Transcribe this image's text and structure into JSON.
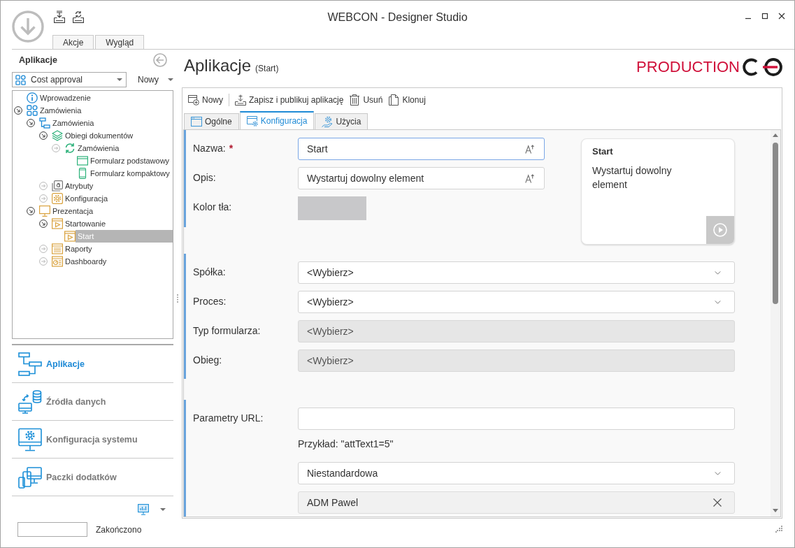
{
  "window": {
    "title": "WEBCON - Designer Studio"
  },
  "ribbon_tabs": [
    {
      "label": "Akcje",
      "selected": false
    },
    {
      "label": "Wygląd",
      "selected": false
    }
  ],
  "sidebar": {
    "title": "Aplikacje",
    "application_select": {
      "value": "Cost approval"
    },
    "new_menu": {
      "label": "Nowy"
    },
    "tree": [
      {
        "label": "Wprowadzenie",
        "kind": "info",
        "selected": false
      },
      {
        "label": "Zamówienia",
        "kind": "app",
        "selected": false,
        "expanded": true,
        "children": [
          {
            "label": "Zamówienia",
            "kind": "process",
            "selected": false,
            "expanded": true,
            "children": [
              {
                "label": "Obiegi dokumentów",
                "kind": "layers",
                "selected": false,
                "expanded": true,
                "children": [
                  {
                    "label": "Zamówienia",
                    "kind": "cycle",
                    "selected": false,
                    "expanded": false,
                    "children": [
                      {
                        "label": "Formularz podstawowy",
                        "kind": "form",
                        "selected": false
                      },
                      {
                        "label": "Formularz kompaktowy",
                        "kind": "mobile",
                        "selected": false
                      }
                    ]
                  }
                ]
              },
              {
                "label": "Atrybuty",
                "kind": "attributes",
                "selected": false,
                "expanded": false
              },
              {
                "label": "Konfiguracja",
                "kind": "settings",
                "selected": false,
                "expanded": false
              }
            ]
          },
          {
            "label": "Prezentacja",
            "kind": "monitor",
            "selected": false,
            "expanded": true,
            "children": [
              {
                "label": "Startowanie",
                "kind": "start",
                "selected": false,
                "expanded": true,
                "children": [
                  {
                    "label": "Start",
                    "kind": "start",
                    "selected": true
                  }
                ]
              },
              {
                "label": "Raporty",
                "kind": "reports",
                "selected": false,
                "expanded": false
              },
              {
                "label": "Dashboardy",
                "kind": "dashboards",
                "selected": false,
                "expanded": false
              }
            ]
          }
        ]
      }
    ],
    "nav": [
      {
        "label": "Aplikacje",
        "kind": "applications",
        "selected": true
      },
      {
        "label": "Źródła danych",
        "kind": "datasources",
        "selected": false
      },
      {
        "label": "Konfiguracja systemu",
        "kind": "system",
        "selected": false
      },
      {
        "label": "Paczki dodatków",
        "kind": "packages",
        "selected": false
      }
    ]
  },
  "status_bar": {
    "text": "Zakończono"
  },
  "header": {
    "title": "Aplikacje",
    "subtitle": "(Start)",
    "environment": "PRODUCTION"
  },
  "toolbar": {
    "groups": [
      {
        "buttons": [
          {
            "label": "Nowy",
            "kind": "new"
          }
        ]
      },
      {
        "buttons": [
          {
            "label": "Zapisz i publikuj aplikację",
            "kind": "publish"
          },
          {
            "label": "Usuń",
            "kind": "delete"
          },
          {
            "label": "Klonuj",
            "kind": "clone"
          }
        ]
      }
    ]
  },
  "tabs": [
    {
      "label": "Ogólne",
      "kind": "general",
      "selected": false
    },
    {
      "label": "Konfiguracja",
      "kind": "configuration",
      "selected": true
    },
    {
      "label": "Użycia",
      "kind": "usage",
      "selected": false
    }
  ],
  "form": {
    "preview": {
      "title": "Start",
      "description": "Wystartuj dowolny element"
    },
    "sections": [
      {
        "fields": [
          {
            "kind": "text",
            "label": "Nazwa:",
            "required_mark": "*",
            "value": "Start",
            "focused": true
          },
          {
            "kind": "text",
            "label": "Opis:",
            "value": "Wystartuj dowolny element",
            "focused": false
          },
          {
            "kind": "color",
            "label": "Kolor tła:",
            "color": "#c8c8ca"
          }
        ]
      },
      {
        "fields": [
          {
            "kind": "select",
            "label": "Spółka:",
            "value": "<Wybierz>",
            "disabled": false
          },
          {
            "kind": "select",
            "label": "Proces:",
            "value": "<Wybierz>",
            "disabled": false
          },
          {
            "kind": "select",
            "label": "Typ formularza:",
            "value": "<Wybierz>",
            "disabled": true
          },
          {
            "kind": "select",
            "label": "Obieg:",
            "value": "<Wybierz>",
            "disabled": true
          }
        ]
      },
      {
        "fields": [
          {
            "kind": "input",
            "label": "Parametry URL:",
            "focused": false
          },
          {
            "kind": "hint",
            "text": "Przykład: \"attText1=5\""
          },
          {
            "kind": "select",
            "value": "Niestandardowa",
            "disabled": false
          },
          {
            "kind": "person",
            "value": "ADM Pawel"
          }
        ]
      }
    ]
  }
}
